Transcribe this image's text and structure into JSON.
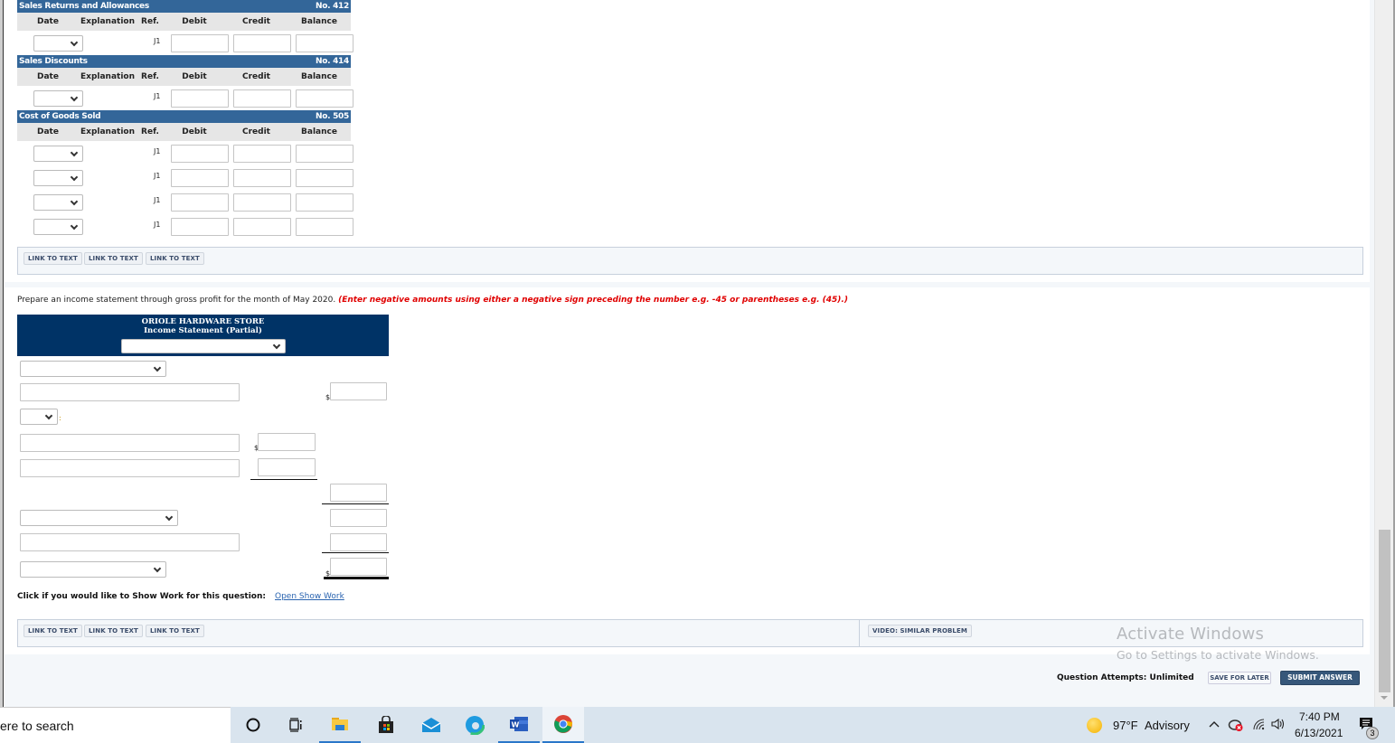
{
  "ledgers": [
    {
      "title": "Sales Returns and Allowances",
      "number": "No. 412",
      "columns": [
        "Date",
        "Explanation",
        "Ref.",
        "Debit",
        "Credit",
        "Balance"
      ],
      "rows": [
        {
          "date": "",
          "ref": "J1",
          "debit": "",
          "credit": "",
          "balance": ""
        }
      ]
    },
    {
      "title": "Sales Discounts",
      "number": "No. 414",
      "columns": [
        "Date",
        "Explanation",
        "Ref.",
        "Debit",
        "Credit",
        "Balance"
      ],
      "rows": [
        {
          "date": "",
          "ref": "J1",
          "debit": "",
          "credit": "",
          "balance": ""
        }
      ]
    },
    {
      "title": "Cost of Goods Sold",
      "number": "No. 505",
      "columns": [
        "Date",
        "Explanation",
        "Ref.",
        "Debit",
        "Credit",
        "Balance"
      ],
      "rows": [
        {
          "date": "",
          "ref": "J1",
          "debit": "",
          "credit": "",
          "balance": ""
        },
        {
          "date": "",
          "ref": "J1",
          "debit": "",
          "credit": "",
          "balance": ""
        },
        {
          "date": "",
          "ref": "J1",
          "debit": "",
          "credit": "",
          "balance": ""
        },
        {
          "date": "",
          "ref": "J1",
          "debit": "",
          "credit": "",
          "balance": ""
        }
      ]
    }
  ],
  "links_top": [
    "LINK TO TEXT",
    "LINK TO TEXT",
    "LINK TO TEXT"
  ],
  "instructions": {
    "text": "Prepare an income statement through gross profit for the month of May 2020. ",
    "note": "(Enter negative amounts using either a negative sign preceding the number e.g. -45 or parentheses e.g. (45).)"
  },
  "income_statement": {
    "company": "ORIOLE HARDWARE STORE",
    "title": "Income Statement (Partial)",
    "period_select": "",
    "currency_symbol": "$",
    "colon": ":"
  },
  "show_work": {
    "label": "Click if you would like to Show Work for this question:",
    "link": "Open Show Work"
  },
  "links_bottom": [
    "LINK TO TEXT",
    "LINK TO TEXT",
    "LINK TO TEXT"
  ],
  "video_button": "VIDEO: SIMILAR PROBLEM",
  "watermark": {
    "line1": "Activate Windows",
    "line2": "Go to Settings to activate Windows."
  },
  "footer": {
    "attempts": "Question Attempts: Unlimited",
    "save": "SAVE FOR LATER",
    "submit": "SUBMIT ANSWER"
  },
  "taskbar": {
    "search_placeholder": "ere to search",
    "weather_temp": "97°F",
    "weather_status": "Advisory",
    "time": "7:40 PM",
    "date": "6/13/2021",
    "notification_count": "3",
    "apps": [
      "cortana",
      "task-view",
      "file-explorer",
      "microsoft-store",
      "mail",
      "edge",
      "word",
      "chrome"
    ]
  }
}
